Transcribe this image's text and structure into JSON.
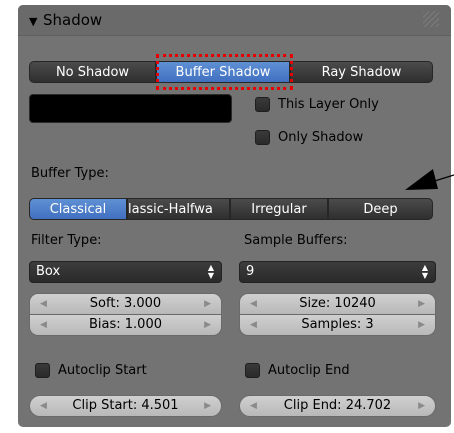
{
  "panel": {
    "title": "Shadow"
  },
  "shadow_modes": {
    "options": [
      "No Shadow",
      "Buffer Shadow",
      "Ray Shadow"
    ],
    "selected": "Buffer Shadow"
  },
  "shadow_color": "#000000",
  "this_layer_only": {
    "label": "This Layer Only",
    "checked": false
  },
  "only_shadow": {
    "label": "Only Shadow",
    "checked": false
  },
  "buffer_type": {
    "label": "Buffer Type:",
    "options": [
      "Classical",
      "lassic-Halfwa",
      "Irregular",
      "Deep"
    ],
    "selected": "Classical"
  },
  "filter_type": {
    "label": "Filter Type:",
    "value": "Box"
  },
  "sample_buffers": {
    "label": "Sample Buffers:",
    "value": "9"
  },
  "soft": "Soft: 3.000",
  "bias": "Bias: 1.000",
  "size": "Size: 10240",
  "samples": "Samples: 3",
  "autoclip_start": {
    "label": "Autoclip Start",
    "checked": false
  },
  "autoclip_end": {
    "label": "Autoclip End",
    "checked": false
  },
  "clip_start": "Clip Start: 4.501",
  "clip_end": "Clip End: 24.702",
  "icons": {
    "collapse": "▼",
    "up_down": "▲▼",
    "left": "◀",
    "right": "▶"
  },
  "colors": {
    "accent": "#5680c8",
    "highlight": "#e60000"
  }
}
